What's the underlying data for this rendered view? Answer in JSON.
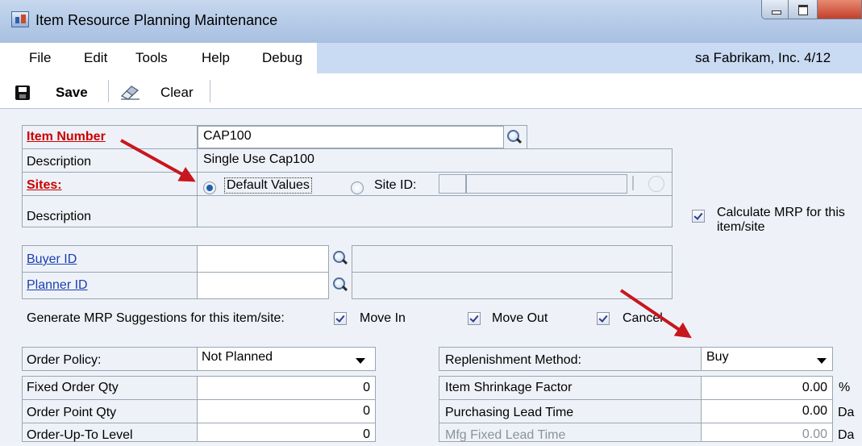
{
  "window": {
    "title": "Item Resource Planning Maintenance"
  },
  "menu": {
    "items": [
      "File",
      "Edit",
      "Tools",
      "Help",
      "Debug"
    ],
    "company": "sa  Fabrikam, Inc.  4/12"
  },
  "toolbar": {
    "save_label": "Save",
    "clear_label": "Clear"
  },
  "form": {
    "item_number_label": "Item Number",
    "item_number_value": "CAP100",
    "description_label": "Description",
    "description_value": "Single Use Cap100",
    "sites_label": "Sites:",
    "default_values_label": "Default Values",
    "site_id_label": "Site ID:",
    "site_description_label": "Description",
    "calculate_mrp_label_line1": "Calculate MRP for this",
    "calculate_mrp_label_line2": "item/site",
    "buyer_id_label": "Buyer ID",
    "planner_id_label": "Planner ID",
    "generate_label": "Generate MRP Suggestions for this item/site:",
    "move_in_label": "Move In",
    "move_out_label": "Move Out",
    "cancel_label": "Cancel",
    "order_policy_label": "Order Policy:",
    "order_policy_value": "Not Planned",
    "fixed_order_qty_label": "Fixed Order Qty",
    "fixed_order_qty_value": "0",
    "order_point_qty_label": "Order Point Qty",
    "order_point_qty_value": "0",
    "order_up_to_level_label": "Order-Up-To Level",
    "order_up_to_level_value": "0",
    "replenishment_label": "Replenishment Method:",
    "replenishment_value": "Buy",
    "shrinkage_label": "Item Shrinkage Factor",
    "shrinkage_value": "0.00",
    "shrinkage_unit": "%",
    "purchasing_lead_label": "Purchasing Lead Time",
    "purchasing_lead_value": "0.00",
    "purchasing_lead_unit": "Da",
    "mfg_fixed_lead_label": "Mfg Fixed Lead Time",
    "mfg_fixed_lead_value": "0.00",
    "mfg_fixed_lead_unit": "Da"
  },
  "colors": {
    "required_label": "#cc0000",
    "link": "#1a3fb0",
    "annotation_arrow": "#c8161d"
  }
}
